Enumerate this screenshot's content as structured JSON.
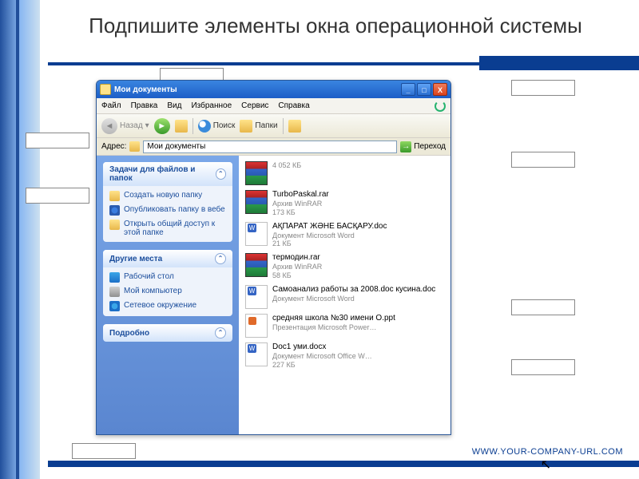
{
  "slide": {
    "title": "Подпишите элементы окна операционной системы",
    "footer_url": "WWW.YOUR-COMPANY-URL.COM"
  },
  "window": {
    "title": "Мои документы",
    "controls": {
      "min": "_",
      "max": "□",
      "close": "X"
    }
  },
  "menubar": [
    "Файл",
    "Правка",
    "Вид",
    "Избранное",
    "Сервис",
    "Справка"
  ],
  "toolbar": {
    "back": "Назад",
    "search": "Поиск",
    "folders": "Папки"
  },
  "addressbar": {
    "label": "Адрес:",
    "value": "Мои документы",
    "go": "Переход"
  },
  "sidebar": {
    "panels": [
      {
        "title": "Задачи для файлов и папок",
        "items": [
          {
            "icon": "pi-newf",
            "label": "Создать новую папку"
          },
          {
            "icon": "pi-pub",
            "label": "Опубликовать папку в вебе"
          },
          {
            "icon": "pi-share",
            "label": "Открыть общий доступ к этой папке"
          }
        ]
      },
      {
        "title": "Другие места",
        "items": [
          {
            "icon": "pi-desk",
            "label": "Рабочий стол"
          },
          {
            "icon": "pi-comp",
            "label": "Мой компьютер"
          },
          {
            "icon": "pi-net",
            "label": "Сетевое окружение"
          }
        ]
      },
      {
        "title": "Подробно",
        "items": []
      }
    ]
  },
  "files": [
    {
      "icon": "rar",
      "name": "",
      "meta1": "",
      "meta2": "4 052 КБ"
    },
    {
      "icon": "rar",
      "name": "TurboPaskal.rar",
      "meta1": "Архив WinRAR",
      "meta2": "173 КБ"
    },
    {
      "icon": "doc",
      "name": "АҚПАРАТ ЖӘНЕ БАСҚАРУ.doc",
      "meta1": "Документ Microsoft Word",
      "meta2": "21 КБ"
    },
    {
      "icon": "rar",
      "name": "термодин.rar",
      "meta1": "Архив WinRAR",
      "meta2": "58 КБ"
    },
    {
      "icon": "doc",
      "name": "Самоанализ работы за 2008.doc кусина.doc",
      "meta1": "Документ Microsoft Word",
      "meta2": ""
    },
    {
      "icon": "ppt",
      "name": "средняя школа №30 имени О.ppt",
      "meta1": "Презентация Microsoft Power…",
      "meta2": ""
    },
    {
      "icon": "doc",
      "name": "Doc1 уми.docx",
      "meta1": "Документ Microsoft Office W…",
      "meta2": "227 КБ"
    }
  ]
}
